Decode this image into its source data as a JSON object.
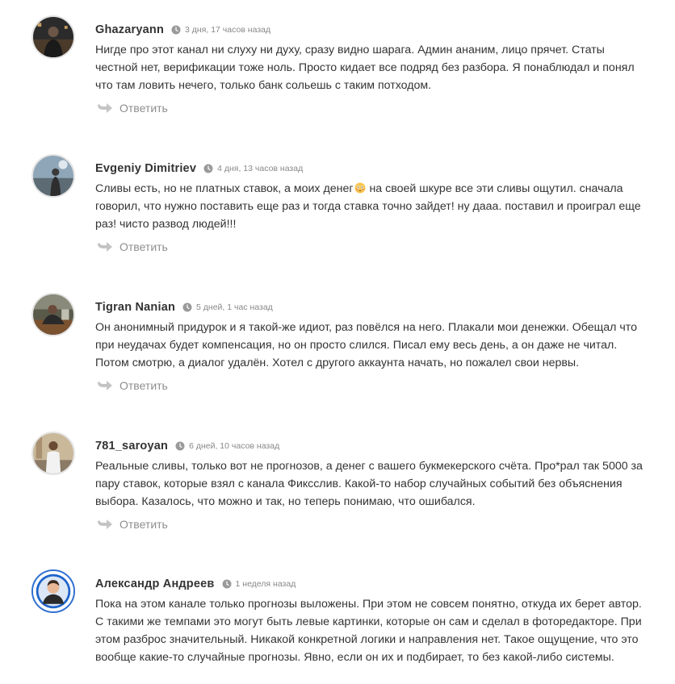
{
  "comments": [
    {
      "author": "Ghazaryann",
      "time": "3 дня, 17 часов назад",
      "text": "Нигде про этот канал ни слуху ни духу, сразу видно шарага. Админ ананим, лицо прячет. Статы честной нет, верификации тоже ноль. Просто кидает все подряд без разбора. Я понаблюдал и понял что там ловить нечего, только банк сольешь с таким потходом.",
      "reply_label": "Ответить"
    },
    {
      "author": "Evgeniy Dimitriev",
      "time": "4 дня, 13 часов назад",
      "text_before_emoji": "Сливы есть, но не платных ставок, а моих денег",
      "emoji": "flushed-face-emoji",
      "text_after_emoji": " на своей шкуре все эти сливы ощутил. сначала говорил, что нужно поставить еще раз и тогда ставка точно зайдет! ну дааа. поставил и проиграл еще раз! чисто развод людей!!!",
      "reply_label": "Ответить"
    },
    {
      "author": "Tigran Nanian",
      "time": "5 дней, 1 час назад",
      "text": "Он анонимный придурок и я такой-же идиот, раз повёлся на него. Плакали мои денежки. Обещал что при неудачах будет компенсация, но он просто слился. Писал ему весь день, а он даже не читал. Потом смотрю, а диалог удалён. Хотел с другого аккаунта начать, но пожалел свои нервы.",
      "reply_label": "Ответить"
    },
    {
      "author": "781_saroyan",
      "time": "6 дней, 10 часов назад",
      "text": "Реальные сливы, только вот не прогнозов, а денег с вашего букмекерского счёта. Про*рал так 5000 за пару ставок, которые взял с канала Фикcслив. Какой-то набор случайных событий без объяснения выбора. Казалось, что можно и так, но теперь понимаю, что ошибался.",
      "reply_label": "Ответить"
    },
    {
      "author": "Александр Андреев",
      "time": "1 неделя назад",
      "text": "Пока на этом канале только прогнозы выложены. При этом не совсем понятно, откуда их берет автор. С такими же темпами это могут быть левые картинки, которые он сам и сделал в фоторедакторе. При этом разброс значительный. Никакой конкретной логики и направления нет. Такое ощущение, что это вообще какие-то случайные прогнозы. Явно, если он их и подбирает, то без какой-либо системы.",
      "reply_label": ""
    }
  ],
  "colors": {
    "author": "#333333",
    "meta": "#888888",
    "text": "#333333",
    "reply": "#8e8e8e",
    "avatar_border": "#e4e4e4"
  },
  "icons": [
    "clock-icon",
    "reply-arrow-icon"
  ]
}
